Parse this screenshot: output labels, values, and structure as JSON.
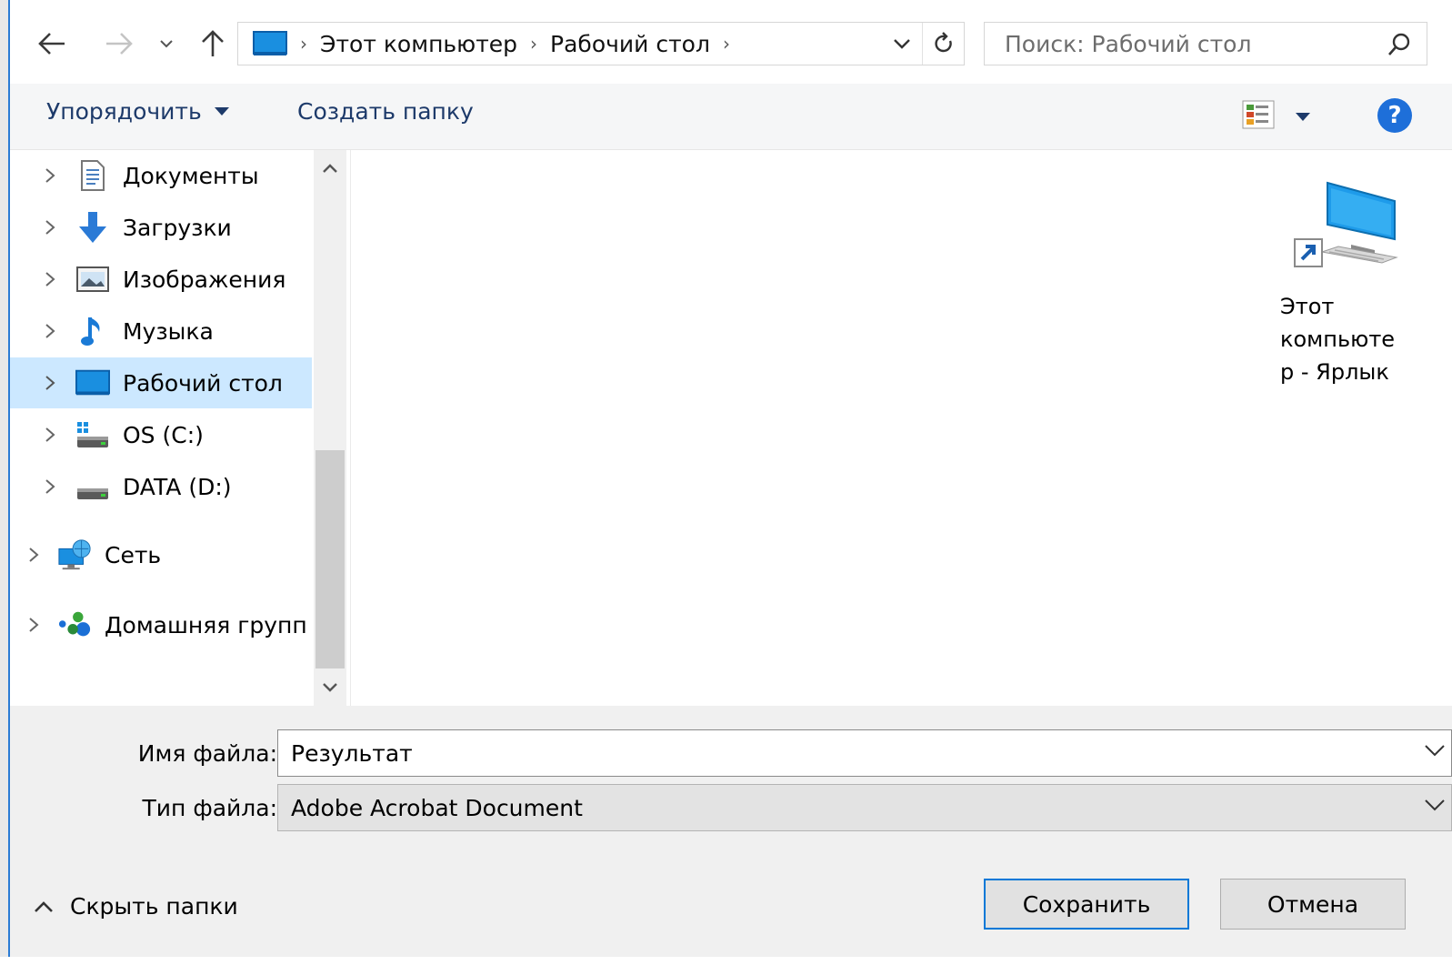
{
  "address": {
    "crumbs": [
      "Этот компьютер",
      "Рабочий стол"
    ],
    "search_placeholder": "Поиск: Рабочий стол"
  },
  "toolbar": {
    "organize_label": "Упорядочить",
    "new_folder_label": "Создать папку",
    "help_label": "?"
  },
  "nav": {
    "items": [
      {
        "label": "Документы",
        "icon": "documents-icon"
      },
      {
        "label": "Загрузки",
        "icon": "downloads-icon"
      },
      {
        "label": "Изображения",
        "icon": "pictures-icon"
      },
      {
        "label": "Музыка",
        "icon": "music-icon"
      },
      {
        "label": "Рабочий стол",
        "icon": "desktop-icon",
        "selected": true
      },
      {
        "label": "OS (C:)",
        "icon": "system-drive-icon"
      },
      {
        "label": "DATA (D:)",
        "icon": "drive-icon"
      },
      {
        "label": "Сеть",
        "icon": "network-icon"
      },
      {
        "label": "Домашняя групп",
        "icon": "homegroup-icon"
      }
    ]
  },
  "content": {
    "files": [
      {
        "label": "Этот компьюте\nр - Ярлык",
        "icon": "computer-shortcut-icon"
      }
    ]
  },
  "form": {
    "filename_label": "Имя файла:",
    "filename_value": "Результат",
    "filetype_label": "Тип файла:",
    "filetype_value": "Adobe Acrobat Document"
  },
  "footer": {
    "hide_folders_label": "Скрыть папки",
    "save_label": "Сохранить",
    "cancel_label": "Отмена"
  },
  "colors": {
    "selection": "#cce8ff",
    "accent": "#0078d7",
    "command_text": "#1d3a6a"
  }
}
